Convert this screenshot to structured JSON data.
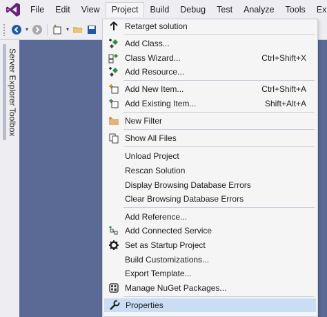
{
  "menubar": {
    "items": [
      "File",
      "Edit",
      "View",
      "Project",
      "Build",
      "Debug",
      "Test",
      "Analyze",
      "Tools",
      "Exten"
    ],
    "active_index": 3
  },
  "sidetabs": [
    "Server Explorer",
    "Toolbox"
  ],
  "project_menu": {
    "items": [
      {
        "label": "Retarget solution",
        "shortcut": "",
        "icon": "up-arrow-icon"
      },
      {
        "label": "Add Class...",
        "shortcut": "",
        "icon": "add-class-icon"
      },
      {
        "label": "Class Wizard...",
        "shortcut": "Ctrl+Shift+X",
        "icon": "class-wizard-icon"
      },
      {
        "label": "Add Resource...",
        "shortcut": "",
        "icon": "add-resource-icon"
      },
      {
        "label": "Add New Item...",
        "shortcut": "Ctrl+Shift+A",
        "icon": "add-new-item-icon"
      },
      {
        "label": "Add Existing Item...",
        "shortcut": "Shift+Alt+A",
        "icon": "add-existing-item-icon"
      },
      {
        "label": "New Filter",
        "shortcut": "",
        "icon": "folder-icon"
      },
      {
        "label": "Show All Files",
        "shortcut": "",
        "icon": "show-all-files-icon"
      },
      {
        "label": "Unload Project",
        "shortcut": "",
        "icon": ""
      },
      {
        "label": "Rescan Solution",
        "shortcut": "",
        "icon": ""
      },
      {
        "label": "Display Browsing Database Errors",
        "shortcut": "",
        "icon": ""
      },
      {
        "label": "Clear Browsing Database Errors",
        "shortcut": "",
        "icon": ""
      },
      {
        "label": "Add Reference...",
        "shortcut": "",
        "icon": ""
      },
      {
        "label": "Add Connected Service",
        "shortcut": "",
        "icon": "connected-service-icon"
      },
      {
        "label": "Set as Startup Project",
        "shortcut": "",
        "icon": "gear-icon"
      },
      {
        "label": "Build Customizations...",
        "shortcut": "",
        "icon": ""
      },
      {
        "label": "Export Template...",
        "shortcut": "",
        "icon": ""
      },
      {
        "label": "Manage NuGet Packages...",
        "shortcut": "",
        "icon": "nuget-icon"
      },
      {
        "label": "Properties",
        "shortcut": "",
        "icon": "wrench-icon"
      }
    ],
    "selected_label": "Properties"
  },
  "colors": {
    "accent": "#68217a",
    "selected": "#c9def5",
    "background": "#5a6a95"
  }
}
